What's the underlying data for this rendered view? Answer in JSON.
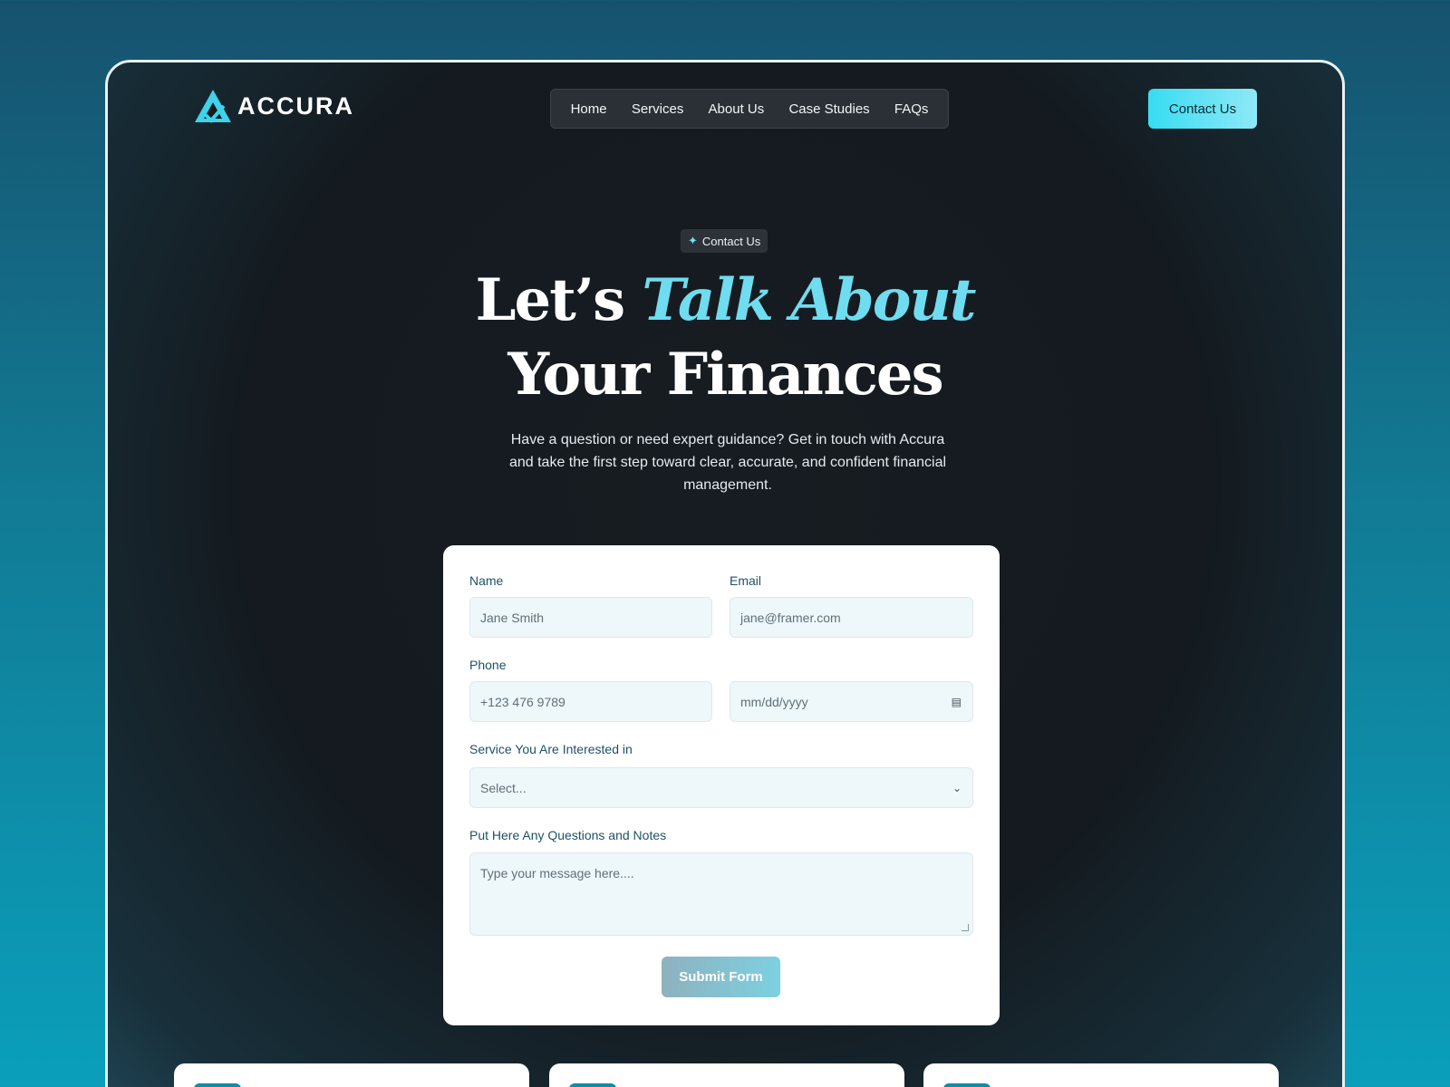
{
  "brand": {
    "name": "ACCURA",
    "accent_color": "#3fd2ea"
  },
  "nav": {
    "items": [
      {
        "label": "Home"
      },
      {
        "label": "Services"
      },
      {
        "label": "About Us"
      },
      {
        "label": "Case Studies"
      },
      {
        "label": "FAQs"
      }
    ],
    "cta_label": "Contact Us"
  },
  "hero": {
    "badge": "Contact Us",
    "title_line1_plain": "Let’s ",
    "title_line1_accent": "Talk About",
    "title_line2": "Your Finances",
    "subtitle": "Have a question or need expert guidance? Get in touch with Accura and take the first step toward clear, accurate, and confident financial management."
  },
  "form": {
    "name_label": "Name",
    "name_placeholder": "Jane Smith",
    "email_label": "Email",
    "email_placeholder": "jane@framer.com",
    "phone_label": "Phone",
    "phone_placeholder": "+123 476 9789",
    "date_placeholder": "mm/dd/yyyy",
    "service_label": "Service You Are Interested in",
    "service_selected": "Select...",
    "notes_label": "Put Here Any Questions and Notes",
    "notes_placeholder": "Type your message here....",
    "submit_label": "Submit Form"
  }
}
